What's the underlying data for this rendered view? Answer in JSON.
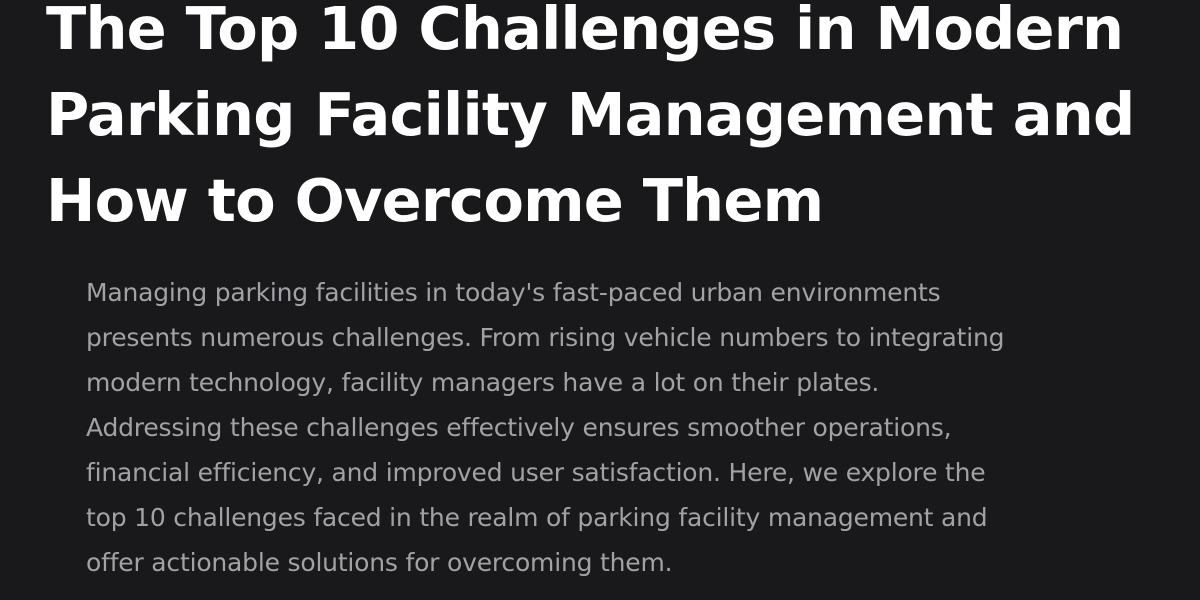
{
  "article": {
    "title_lines": [
      "The Top 10 Challenges in Modern",
      "Parking Facility Management and",
      "How to Overcome Them"
    ],
    "intro_lines": [
      "Managing parking facilities in today's fast-paced urban environments",
      "presents numerous challenges. From rising vehicle numbers to integrating",
      "modern technology, facility managers have a lot on their plates.",
      "Addressing these challenges effectively ensures smoother operations,",
      "financial efficiency, and improved user satisfaction. Here, we explore the",
      "top 10 challenges faced in the realm of parking facility management and",
      "offer actionable solutions for overcoming them."
    ]
  },
  "colors": {
    "background": "#19191b",
    "title": "#ffffff",
    "body_text": "#a2a2a6"
  }
}
